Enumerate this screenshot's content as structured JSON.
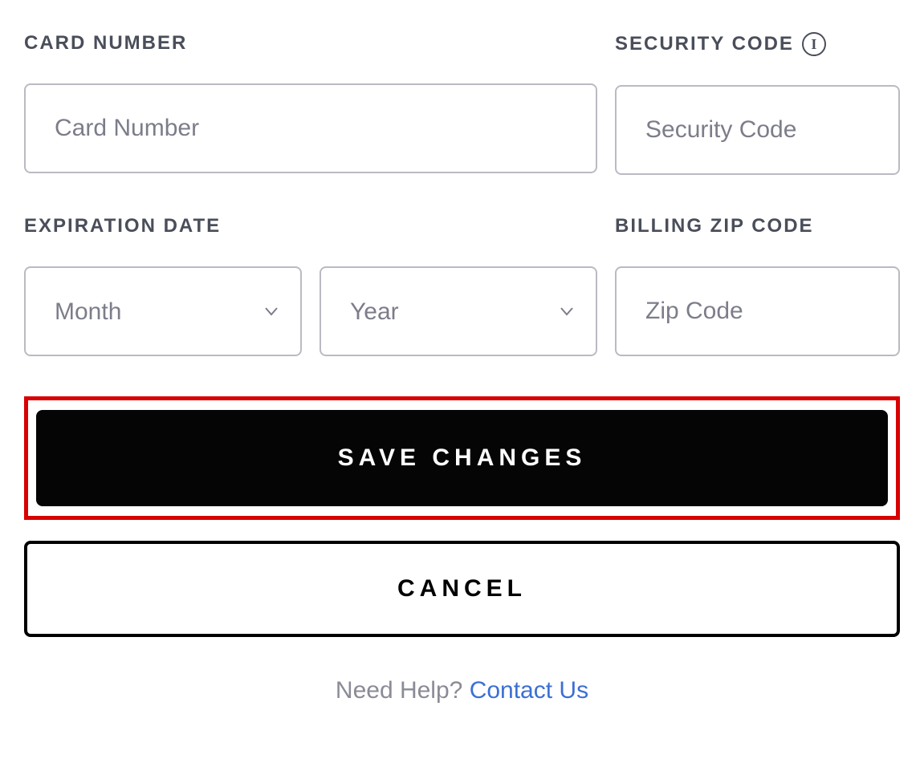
{
  "labels": {
    "card_number": "CARD NUMBER",
    "security_code": "SECURITY CODE",
    "expiration_date": "EXPIRATION DATE",
    "billing_zip": "BILLING ZIP CODE"
  },
  "placeholders": {
    "card_number": "Card Number",
    "security_code": "Security Code",
    "month": "Month",
    "year": "Year",
    "zip": "Zip Code"
  },
  "values": {
    "card_number": "",
    "security_code": "",
    "month": "",
    "year": "",
    "zip": ""
  },
  "buttons": {
    "save": "SAVE CHANGES",
    "cancel": "CANCEL"
  },
  "help": {
    "text": "Need Help? ",
    "link_text": "Contact Us"
  },
  "icons": {
    "info": "i"
  }
}
